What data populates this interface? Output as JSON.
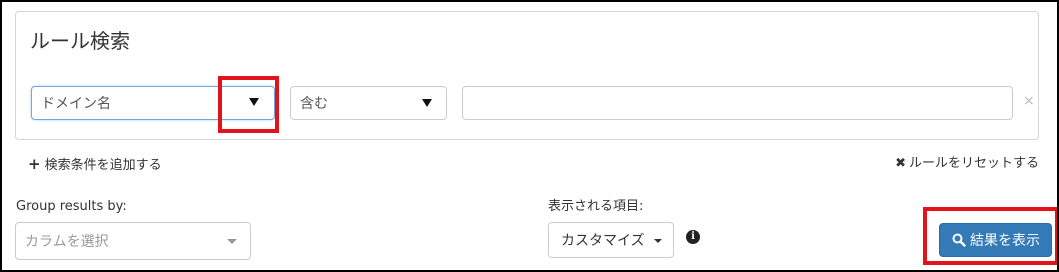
{
  "panel": {
    "title": "ルール検索",
    "rule_row": {
      "field_select": "ドメイン名",
      "condition_select": "含む",
      "value_input": "",
      "clear_icon": "×"
    }
  },
  "actions": {
    "add_condition": "検索条件を追加する",
    "add_icon": "+",
    "reset_rules": "ルールをリセットする",
    "reset_icon": "✖"
  },
  "group_by": {
    "label": "Group results by:",
    "placeholder": "カラムを選択"
  },
  "display_items": {
    "label": "表示される項目:",
    "button": "カスタマイズ",
    "info_icon": "i"
  },
  "submit": {
    "label": "結果を表示",
    "icon": "search-icon"
  },
  "colors": {
    "primary": "#337ab7",
    "highlight": "#e3131b",
    "border": "#cccccc"
  }
}
